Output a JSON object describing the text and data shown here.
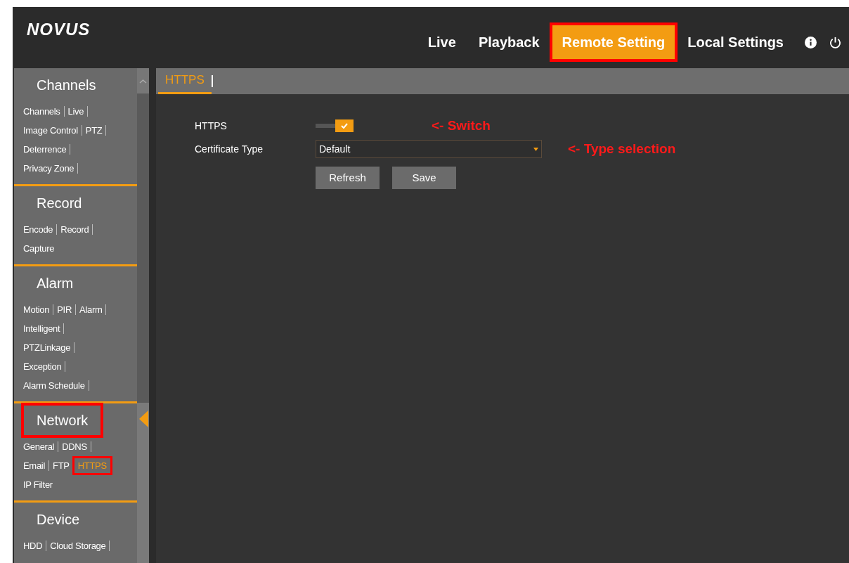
{
  "header": {
    "logo": "NOVUS",
    "nav": [
      {
        "label": "Live",
        "selected": false,
        "highlighted": false
      },
      {
        "label": "Playback",
        "selected": false,
        "highlighted": false
      },
      {
        "label": "Remote Setting",
        "selected": true,
        "highlighted": true
      },
      {
        "label": "Local Settings",
        "selected": false,
        "highlighted": false
      }
    ]
  },
  "sidebar": {
    "groups": [
      {
        "title": "Channels",
        "active": false,
        "highlighted": false,
        "rows": [
          [
            {
              "label": "Channels",
              "selected": false,
              "highlighted": false,
              "separator": true
            },
            {
              "label": "Live",
              "selected": false,
              "highlighted": false,
              "separator": true
            }
          ],
          [
            {
              "label": "Image Control",
              "selected": false,
              "highlighted": false,
              "separator": true
            },
            {
              "label": "PTZ",
              "selected": false,
              "highlighted": false,
              "separator": true
            }
          ],
          [
            {
              "label": "Deterrence",
              "selected": false,
              "highlighted": false,
              "separator": true
            }
          ],
          [
            {
              "label": "Privacy Zone",
              "selected": false,
              "highlighted": false,
              "separator": true
            }
          ]
        ]
      },
      {
        "title": "Record",
        "active": false,
        "highlighted": false,
        "rows": [
          [
            {
              "label": "Encode",
              "selected": false,
              "highlighted": false,
              "separator": true
            },
            {
              "label": "Record",
              "selected": false,
              "highlighted": false,
              "separator": true
            }
          ],
          [
            {
              "label": "Capture",
              "selected": false,
              "highlighted": false,
              "separator": false
            }
          ]
        ]
      },
      {
        "title": "Alarm",
        "active": false,
        "highlighted": false,
        "rows": [
          [
            {
              "label": "Motion",
              "selected": false,
              "highlighted": false,
              "separator": true
            },
            {
              "label": "PIR",
              "selected": false,
              "highlighted": false,
              "separator": true
            },
            {
              "label": "Alarm",
              "selected": false,
              "highlighted": false,
              "separator": true
            }
          ],
          [
            {
              "label": "Intelligent",
              "selected": false,
              "highlighted": false,
              "separator": true
            }
          ],
          [
            {
              "label": "PTZLinkage",
              "selected": false,
              "highlighted": false,
              "separator": true
            }
          ],
          [
            {
              "label": "Exception",
              "selected": false,
              "highlighted": false,
              "separator": true
            }
          ],
          [
            {
              "label": "Alarm Schedule",
              "selected": false,
              "highlighted": false,
              "separator": true
            }
          ]
        ]
      },
      {
        "title": "Network",
        "active": true,
        "highlighted": true,
        "rows": [
          [
            {
              "label": "General",
              "selected": false,
              "highlighted": false,
              "separator": true
            },
            {
              "label": "DDNS",
              "selected": false,
              "highlighted": false,
              "separator": true
            }
          ],
          [
            {
              "label": "Email",
              "selected": false,
              "highlighted": false,
              "separator": true
            },
            {
              "label": "FTP",
              "selected": false,
              "highlighted": false,
              "separator": false
            },
            {
              "label": "HTTPS",
              "selected": true,
              "highlighted": true,
              "separator": false
            }
          ],
          [
            {
              "label": "IP Filter",
              "selected": false,
              "highlighted": false,
              "separator": false
            }
          ]
        ]
      },
      {
        "title": "Device",
        "active": false,
        "highlighted": false,
        "rows": [
          [
            {
              "label": "HDD",
              "selected": false,
              "highlighted": false,
              "separator": true
            },
            {
              "label": "Cloud Storage",
              "selected": false,
              "highlighted": false,
              "separator": true
            }
          ]
        ]
      }
    ]
  },
  "tabs": [
    {
      "label": "HTTPS",
      "selected": true
    }
  ],
  "form": {
    "https": {
      "label": "HTTPS",
      "on": true,
      "annotation": "<- Switch"
    },
    "certificate_type": {
      "label": "Certificate Type",
      "value": "Default",
      "annotation": "<- Type selection"
    },
    "buttons": [
      "Refresh",
      "Save"
    ]
  }
}
